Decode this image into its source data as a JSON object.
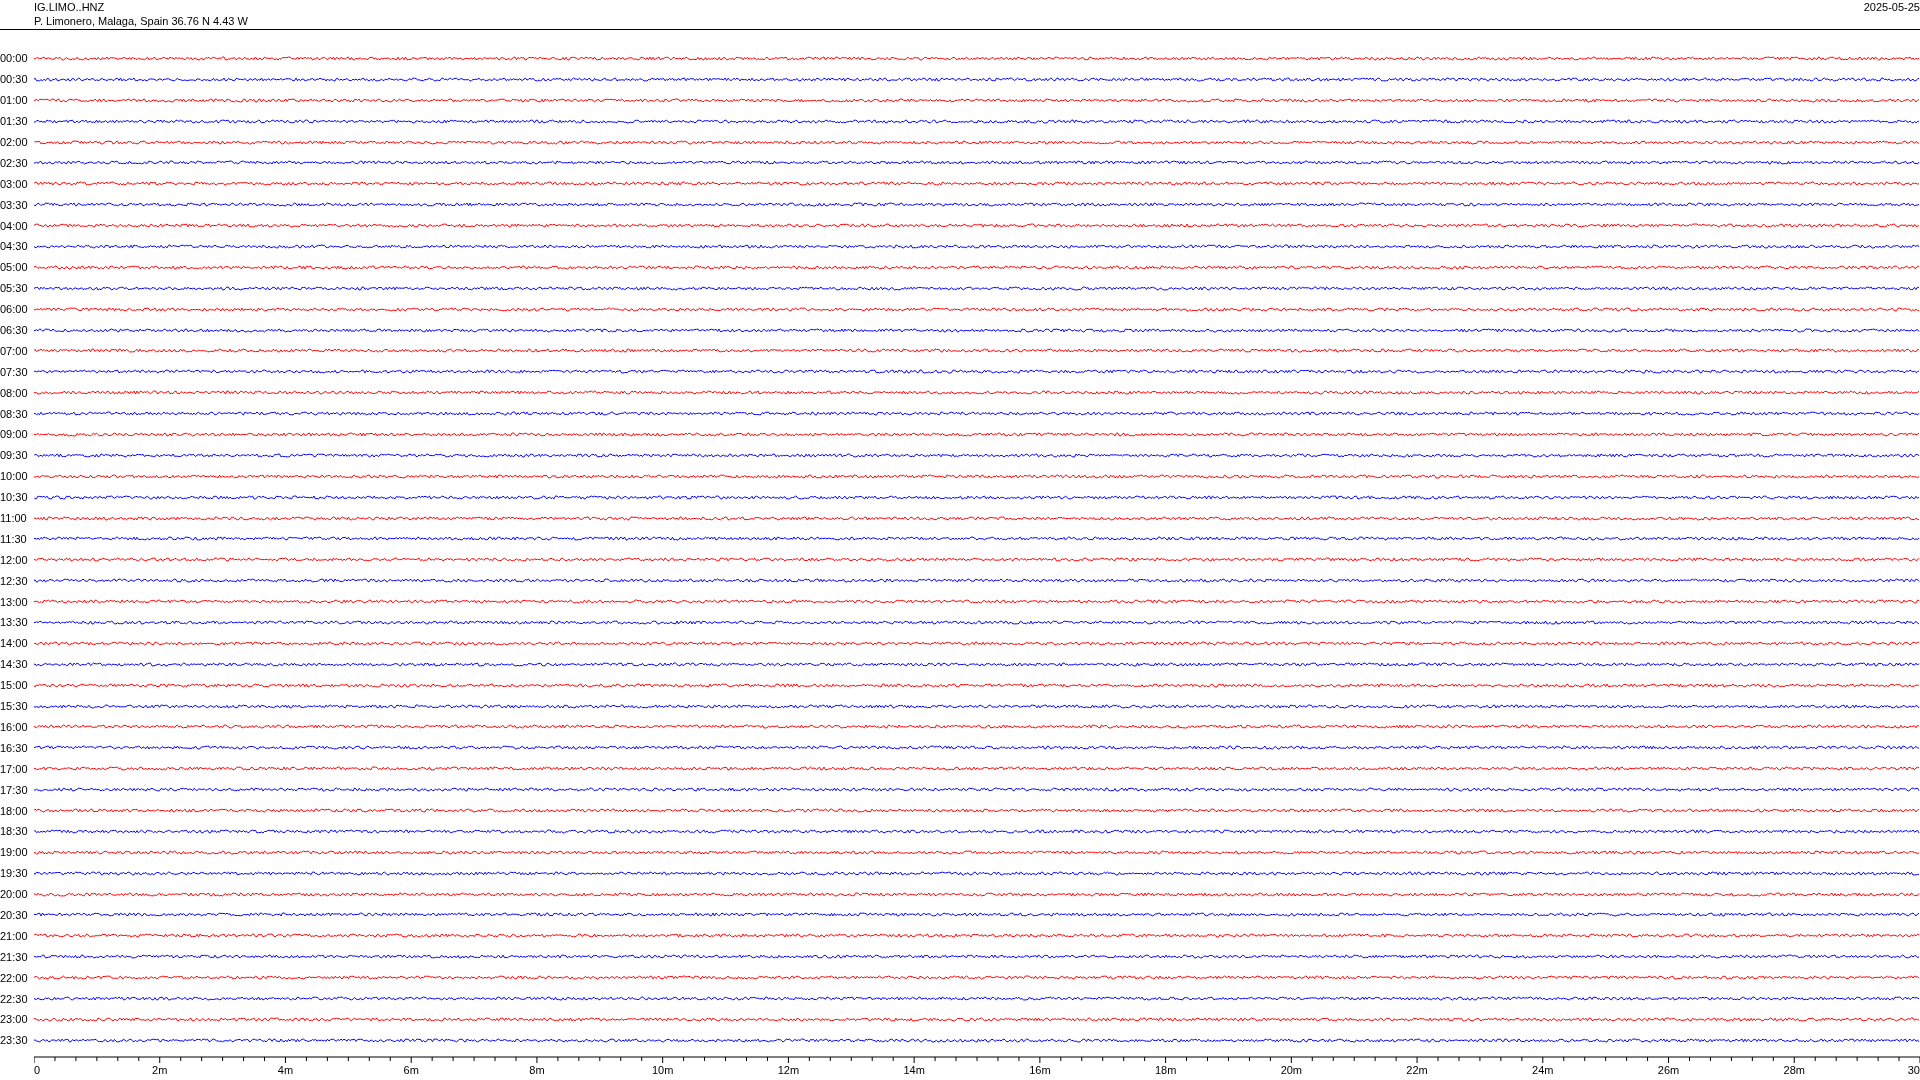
{
  "header": {
    "station": "IG.LIMO..HNZ",
    "location": "P. Limonero, Malaga, Spain  36.76 N 4.43 W",
    "date": "2025-05-25"
  },
  "rows": [
    {
      "label": "00:00",
      "color": "#ff0000"
    },
    {
      "label": "00:30",
      "color": "#0000ff"
    },
    {
      "label": "01:00",
      "color": "#ff0000"
    },
    {
      "label": "01:30",
      "color": "#0000ff"
    },
    {
      "label": "02:00",
      "color": "#ff0000"
    },
    {
      "label": "02:30",
      "color": "#0000ff"
    },
    {
      "label": "03:00",
      "color": "#ff0000"
    },
    {
      "label": "03:30",
      "color": "#0000ff"
    },
    {
      "label": "04:00",
      "color": "#ff0000"
    },
    {
      "label": "04:30",
      "color": "#0000ff"
    },
    {
      "label": "05:00",
      "color": "#ff0000"
    },
    {
      "label": "05:30",
      "color": "#0000ff"
    },
    {
      "label": "06:00",
      "color": "#ff0000"
    },
    {
      "label": "06:30",
      "color": "#0000ff"
    },
    {
      "label": "07:00",
      "color": "#ff0000"
    },
    {
      "label": "07:30",
      "color": "#0000ff"
    },
    {
      "label": "08:00",
      "color": "#ff0000"
    },
    {
      "label": "08:30",
      "color": "#0000ff"
    },
    {
      "label": "09:00",
      "color": "#ff0000"
    },
    {
      "label": "09:30",
      "color": "#0000ff"
    },
    {
      "label": "10:00",
      "color": "#ff0000"
    },
    {
      "label": "10:30",
      "color": "#0000ff"
    },
    {
      "label": "11:00",
      "color": "#ff0000"
    },
    {
      "label": "11:30",
      "color": "#0000ff"
    },
    {
      "label": "12:00",
      "color": "#ff0000"
    },
    {
      "label": "12:30",
      "color": "#0000ff"
    },
    {
      "label": "13:00",
      "color": "#ff0000"
    },
    {
      "label": "13:30",
      "color": "#0000ff"
    },
    {
      "label": "14:00",
      "color": "#ff0000"
    },
    {
      "label": "14:30",
      "color": "#0000ff"
    },
    {
      "label": "15:00",
      "color": "#ff0000"
    },
    {
      "label": "15:30",
      "color": "#0000ff"
    },
    {
      "label": "16:00",
      "color": "#ff0000"
    },
    {
      "label": "16:30",
      "color": "#0000ff"
    },
    {
      "label": "17:00",
      "color": "#ff0000"
    },
    {
      "label": "17:30",
      "color": "#0000ff"
    },
    {
      "label": "18:00",
      "color": "#ff0000"
    },
    {
      "label": "18:30",
      "color": "#0000ff"
    },
    {
      "label": "19:00",
      "color": "#ff0000"
    },
    {
      "label": "19:30",
      "color": "#0000ff"
    },
    {
      "label": "20:00",
      "color": "#ff0000"
    },
    {
      "label": "20:30",
      "color": "#0000ff"
    },
    {
      "label": "21:00",
      "color": "#ff0000"
    },
    {
      "label": "21:30",
      "color": "#0000ff"
    },
    {
      "label": "22:00",
      "color": "#ff0000"
    },
    {
      "label": "22:30",
      "color": "#0000ff"
    },
    {
      "label": "23:00",
      "color": "#ff0000"
    },
    {
      "label": "23:30",
      "color": "#0000ff"
    }
  ],
  "time_axis": {
    "labels": [
      "0",
      "2m",
      "4m",
      "6m",
      "8m",
      "10m",
      "12m",
      "14m",
      "16m",
      "18m",
      "20m",
      "22m",
      "24m",
      "26m",
      "28m",
      "30"
    ]
  }
}
